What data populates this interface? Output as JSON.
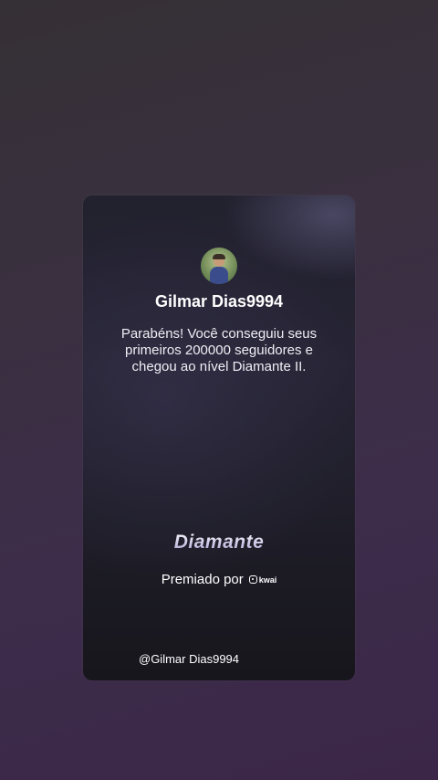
{
  "card": {
    "user_name": "Gilmar Dias9994",
    "message": "Parabéns! Você conseguiu seus primeiros 200000 seguidores e chegou ao nível Diamante II.",
    "level_title": "Diamante",
    "awarded_by": "Premiado por",
    "brand": "kwai",
    "handle": "@Gilmar Dias9994"
  },
  "icons": {
    "avatar": "user-avatar-photo",
    "brand_logo": "kwai-logo-icon"
  }
}
